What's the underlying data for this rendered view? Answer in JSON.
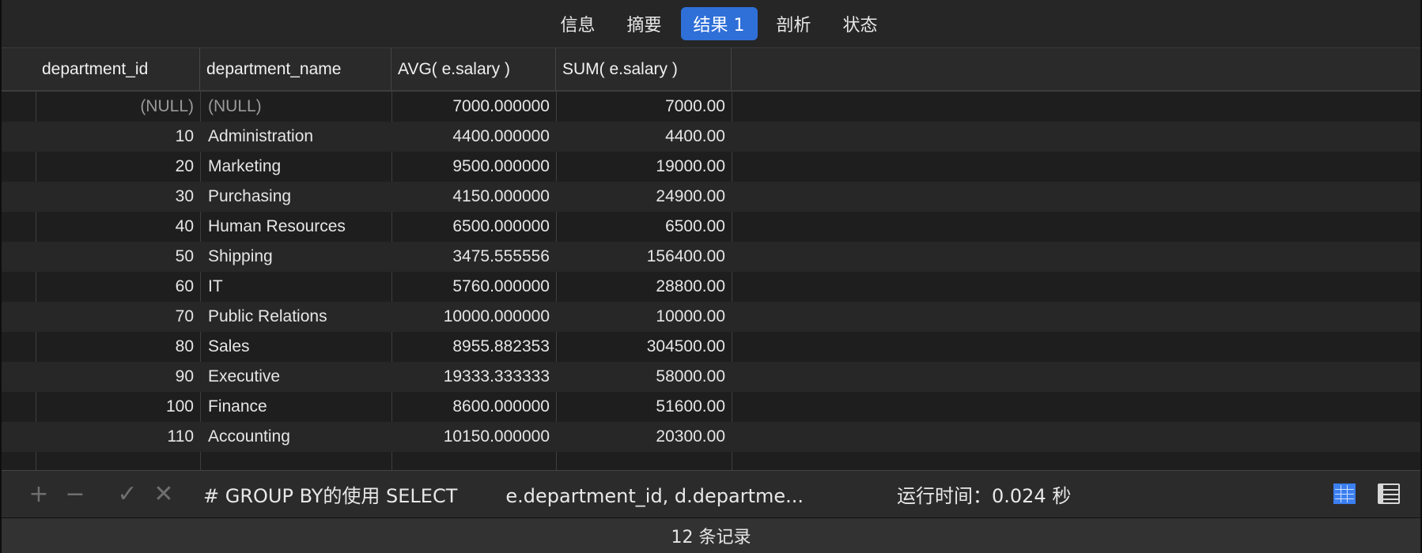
{
  "tabs": [
    {
      "label": "信息",
      "active": false
    },
    {
      "label": "摘要",
      "active": false
    },
    {
      "label": "结果 1",
      "active": true
    },
    {
      "label": "剖析",
      "active": false
    },
    {
      "label": "状态",
      "active": false
    }
  ],
  "table": {
    "columns": [
      "department_id",
      "department_name",
      "AVG( e.salary )",
      "SUM( e.salary )"
    ],
    "rows": [
      {
        "department_id": "(NULL)",
        "department_name": "(NULL)",
        "avg": "7000.000000",
        "sum": "7000.00"
      },
      {
        "department_id": "10",
        "department_name": "Administration",
        "avg": "4400.000000",
        "sum": "4400.00"
      },
      {
        "department_id": "20",
        "department_name": "Marketing",
        "avg": "9500.000000",
        "sum": "19000.00"
      },
      {
        "department_id": "30",
        "department_name": "Purchasing",
        "avg": "4150.000000",
        "sum": "24900.00"
      },
      {
        "department_id": "40",
        "department_name": "Human Resources",
        "avg": "6500.000000",
        "sum": "6500.00"
      },
      {
        "department_id": "50",
        "department_name": "Shipping",
        "avg": "3475.555556",
        "sum": "156400.00"
      },
      {
        "department_id": "60",
        "department_name": "IT",
        "avg": "5760.000000",
        "sum": "28800.00"
      },
      {
        "department_id": "70",
        "department_name": "Public Relations",
        "avg": "10000.000000",
        "sum": "10000.00"
      },
      {
        "department_id": "80",
        "department_name": "Sales",
        "avg": "8955.882353",
        "sum": "304500.00"
      },
      {
        "department_id": "90",
        "department_name": "Executive",
        "avg": "19333.333333",
        "sum": "58000.00"
      },
      {
        "department_id": "100",
        "department_name": "Finance",
        "avg": "8600.000000",
        "sum": "51600.00"
      },
      {
        "department_id": "110",
        "department_name": "Accounting",
        "avg": "10150.000000",
        "sum": "20300.00"
      }
    ]
  },
  "toolbar": {
    "add_icon": "plus-icon",
    "remove_icon": "minus-icon",
    "apply_icon": "check-icon",
    "discard_icon": "cross-icon",
    "add_glyph": "+",
    "remove_glyph": "−",
    "apply_glyph": "✓",
    "discard_glyph": "✕",
    "query": "# GROUP BY的使用 SELECT        e.department_id, d.departme...",
    "runtime": "运行时间：0.024 秒",
    "view_icons": [
      "grid-view-icon",
      "form-view-icon"
    ]
  },
  "status": {
    "record_count": "12 条记录"
  },
  "colors": {
    "accent": "#2f6fd8",
    "background": "#1e1e1e",
    "null_text": "#9a9a9a"
  }
}
